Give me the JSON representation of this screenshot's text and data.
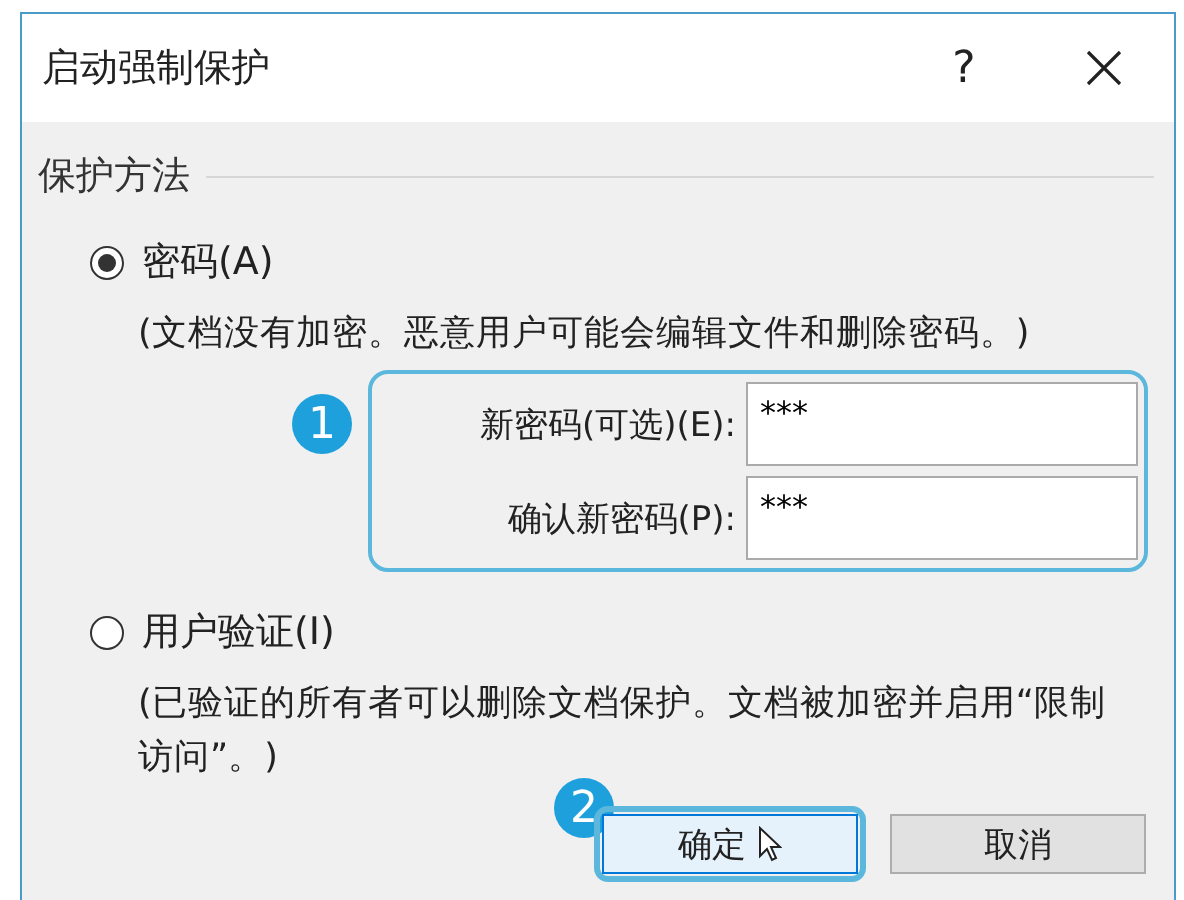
{
  "window": {
    "title": "启动强制保护",
    "help": "?"
  },
  "group": {
    "title": "保护方法"
  },
  "options": [
    {
      "label": "密码(A)",
      "selected": true,
      "description": "(文档没有加密。恶意用户可能会编辑文件和删除密码。)"
    },
    {
      "label": "用户验证(I)",
      "selected": false,
      "description": "(已验证的所有者可以删除文档保护。文档被加密并启用“限制访问”。)"
    }
  ],
  "fields": [
    {
      "label": "新密码(可选)(E):",
      "value": "***"
    },
    {
      "label": "确认新密码(P):",
      "value": "***"
    }
  ],
  "annotations": [
    "1",
    "2"
  ],
  "buttons": [
    {
      "label": "确定",
      "highlighted": true
    },
    {
      "label": "取消",
      "highlighted": false
    }
  ]
}
